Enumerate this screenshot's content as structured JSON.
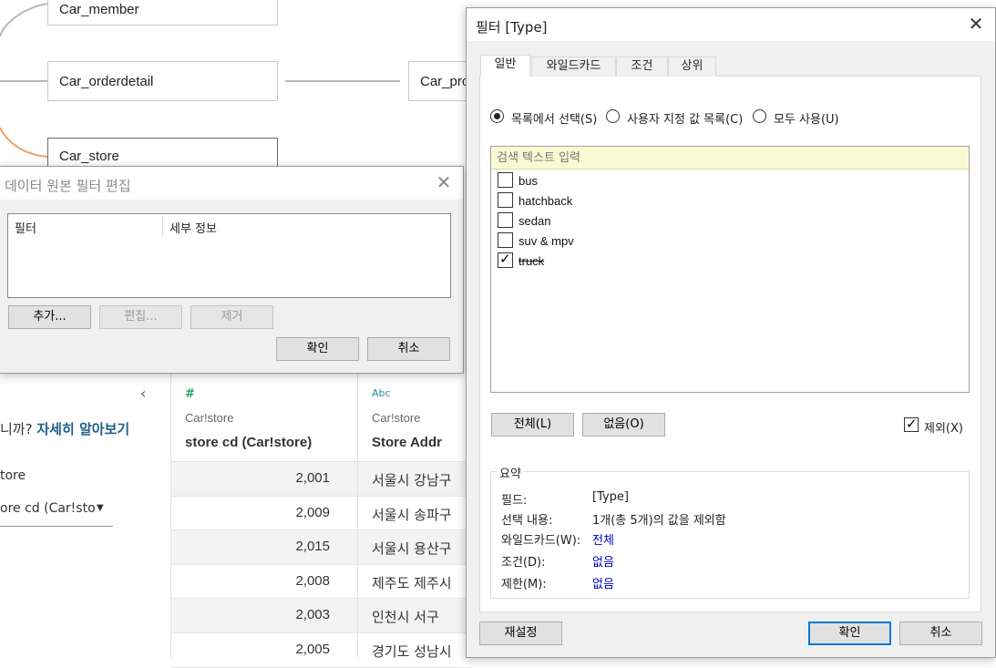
{
  "canvas": {
    "tables": [
      "Car_member",
      "Car_orderdetail",
      "Car_pro",
      "Car_store"
    ],
    "accent_colors": {
      "join_line": "#b9b9b9",
      "relation_curve": "#f0a060"
    }
  },
  "left_panel": {
    "collapse_icon": "chevron-left-icon",
    "hint_text": "니까?",
    "hint_link": "자세히 알아보기",
    "field_label": "tore",
    "field_value": "ore cd (Car!sto"
  },
  "grid": {
    "columns": [
      {
        "type_icon": "#",
        "source": "Car!store",
        "name": "store cd (Car!store)"
      },
      {
        "type_icon": "Abc",
        "source": "Car!store",
        "name": "Store Addr"
      }
    ],
    "rows": [
      {
        "store_cd": "2,001",
        "addr": "서울시 강남구"
      },
      {
        "store_cd": "2,009",
        "addr": "서울시 송파구"
      },
      {
        "store_cd": "2,015",
        "addr": "서울시 용산구"
      },
      {
        "store_cd": "2,008",
        "addr": "제주도 제주시"
      },
      {
        "store_cd": "2,003",
        "addr": "인천시 서구"
      },
      {
        "store_cd": "2,005",
        "addr": "경기도 성남시"
      }
    ]
  },
  "ds_filter_dialog": {
    "title": "데이터 원본 필터 편집",
    "col_filter": "필터",
    "col_detail": "세부 정보",
    "btn_add": "추가...",
    "btn_edit": "편집...",
    "btn_remove": "제거",
    "btn_ok": "확인",
    "btn_cancel": "취소"
  },
  "filter_dialog": {
    "title": "필터 [Type]",
    "tabs": [
      "일반",
      "와일드카드",
      "조건",
      "상위"
    ],
    "radio": {
      "from_list": "목록에서 선택(S)",
      "custom_list": "사용자 지정 값 목록(C)",
      "use_all": "모두 사용(U)"
    },
    "search_placeholder": "검색 텍스트 입력",
    "items": [
      {
        "label": "bus",
        "checked": false
      },
      {
        "label": "hatchback",
        "checked": false
      },
      {
        "label": "sedan",
        "checked": false
      },
      {
        "label": "suv & mpv",
        "checked": false
      },
      {
        "label": "truck",
        "checked": true
      }
    ],
    "btn_all": "전체(L)",
    "btn_none": "없음(O)",
    "exclude_label": "제외(X)",
    "summary": {
      "title": "요약",
      "field_k": "필드:",
      "field_v": "[Type]",
      "selection_k": "선택 내용:",
      "selection_v": "1개(총 5개)의 값을 제외함",
      "wildcard_k": "와일드카드(W):",
      "wildcard_v": "전체",
      "condition_k": "조건(D):",
      "condition_v": "없음",
      "limit_k": "제한(M):",
      "limit_v": "없음"
    },
    "btn_reset": "재설정",
    "btn_ok": "확인",
    "btn_cancel": "취소"
  }
}
